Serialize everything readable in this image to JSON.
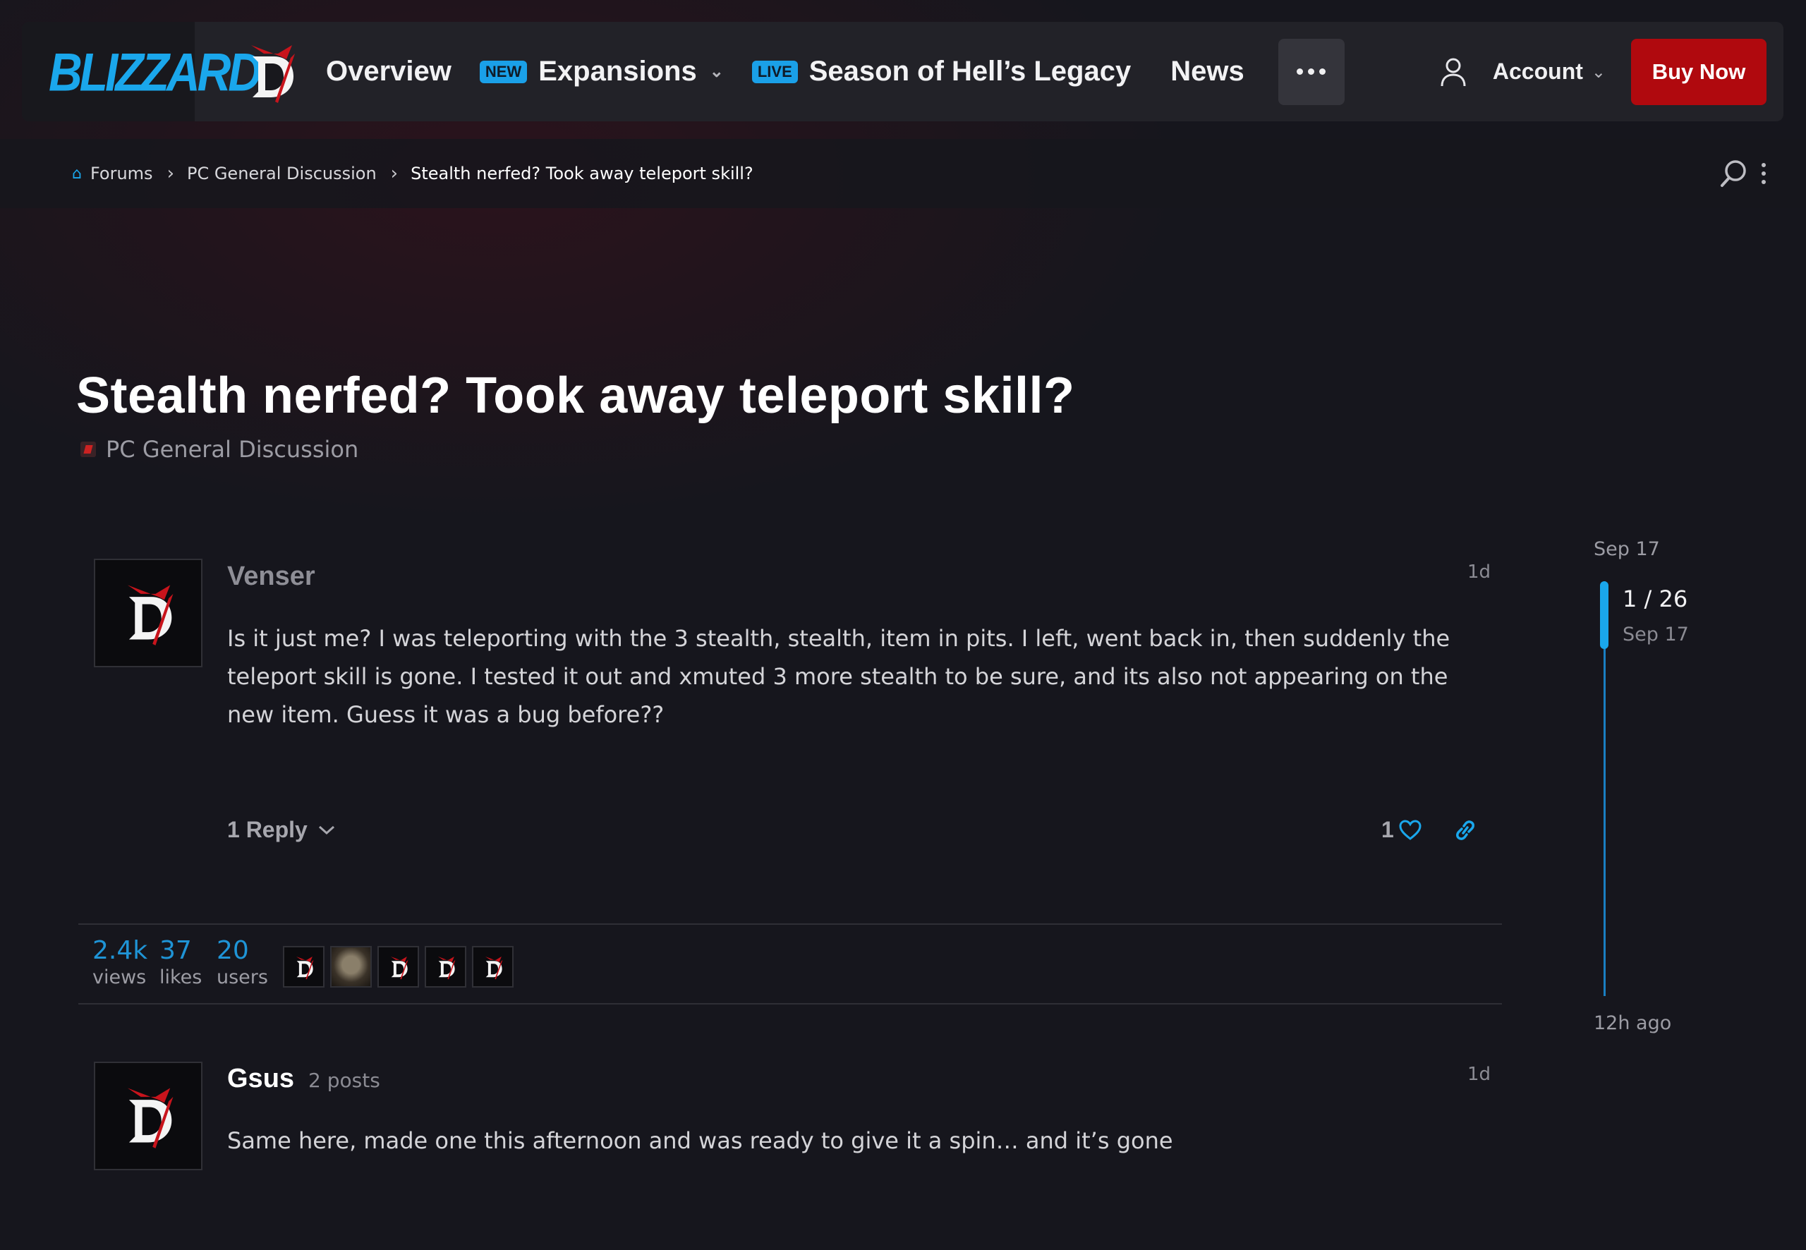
{
  "nav": {
    "brand": "BLIZZARD",
    "items": [
      {
        "label": "Overview"
      },
      {
        "badge": "NEW",
        "label": "Expansions"
      },
      {
        "badge": "LIVE",
        "label": "Season of Hell’s Legacy"
      },
      {
        "label": "News"
      }
    ],
    "account_label": "Account",
    "buy_label": "Buy Now"
  },
  "breadcrumb": {
    "items": [
      "Forums",
      "PC General Discussion",
      "Stealth nerfed? Took away teleport skill?"
    ]
  },
  "topic": {
    "title": "Stealth nerfed? Took away teleport skill?",
    "category": "PC General Discussion"
  },
  "posts": [
    {
      "author": "Venser",
      "age": "1d",
      "body": "Is it just me? I was teleporting with the 3 stealth, stealth, item in pits. I left, went back in, then suddenly the teleport skill is gone. I tested it out and xmuted 3 more stealth to be sure, and its also not appearing on the new item. Guess it was a bug before??",
      "reply_label": "1 Reply",
      "likes": "1"
    },
    {
      "author": "Gsus",
      "post_count": "2 posts",
      "age": "1d",
      "body": "Same here, made one this afternoon and was ready to give it a spin… and it’s gone"
    }
  ],
  "stats": {
    "views_num": "2.4k",
    "views_lbl": "views",
    "likes_num": "37",
    "likes_lbl": "likes",
    "users_num": "20",
    "users_lbl": "users"
  },
  "timeline": {
    "start_date": "Sep 17",
    "position": "1 / 26",
    "position_date": "Sep 17",
    "end_label": "12h ago"
  },
  "colors": {
    "accent": "#1aa7ec",
    "buy": "#b0090e",
    "background": "#16161d"
  }
}
